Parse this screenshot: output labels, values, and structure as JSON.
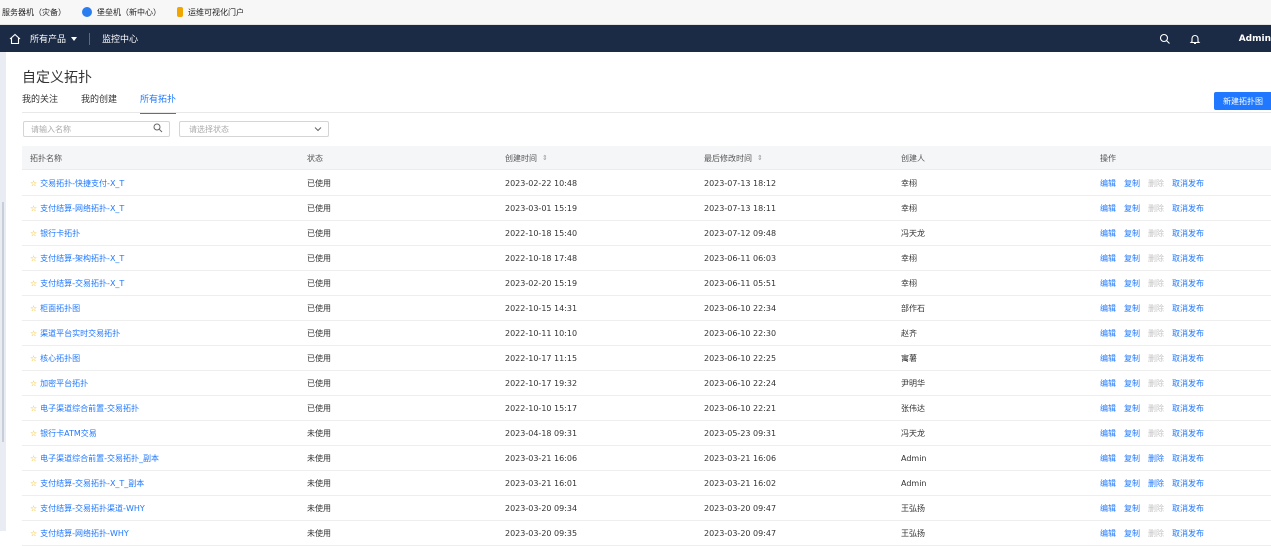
{
  "bookmarks": [
    {
      "label": "服务器机（灾备）",
      "color": "#ffffff"
    },
    {
      "label": "堡垒机（新中心）",
      "color": "#2a7df0"
    },
    {
      "label": "运维可视化门户",
      "color": "#f0a500"
    }
  ],
  "topbar": {
    "home_icon": "home-icon",
    "products_label": "所有产品",
    "monitor_label": "监控中心",
    "user": "Admin"
  },
  "page": {
    "title": "自定义拓扑",
    "tabs": [
      {
        "label": "我的关注",
        "active": false
      },
      {
        "label": "我的创建",
        "active": false
      },
      {
        "label": "所有拓扑",
        "active": true
      }
    ],
    "new_button": "新建拓扑图"
  },
  "filters": {
    "search_placeholder": "请输入名称",
    "status_placeholder": "请选择状态"
  },
  "table": {
    "headers": {
      "name": "拓扑名称",
      "status": "状态",
      "created": "创建时间",
      "modified": "最后修改时间",
      "creator": "创建人",
      "ops": "操作"
    },
    "op_labels": {
      "edit": "编辑",
      "copy": "复制",
      "delete": "删除",
      "unpublish": "取消发布"
    },
    "rows": [
      {
        "name": "交易拓扑-快捷支付-X_T",
        "status": "已使用",
        "created": "2023-02-22 10:48",
        "modified": "2023-07-13 18:12",
        "creator": "幸栩",
        "delete_enabled": false
      },
      {
        "name": "支付结算-网络拓扑-X_T",
        "status": "已使用",
        "created": "2023-03-01 15:19",
        "modified": "2023-07-13 18:11",
        "creator": "幸栩",
        "delete_enabled": false
      },
      {
        "name": "银行卡拓扑",
        "status": "已使用",
        "created": "2022-10-18 15:40",
        "modified": "2023-07-12 09:48",
        "creator": "冯天龙",
        "delete_enabled": false
      },
      {
        "name": "支付结算-架构拓扑-X_T",
        "status": "已使用",
        "created": "2022-10-18 17:48",
        "modified": "2023-06-11 06:03",
        "creator": "幸栩",
        "delete_enabled": false
      },
      {
        "name": "支付结算-交易拓扑-X_T",
        "status": "已使用",
        "created": "2023-02-20 15:19",
        "modified": "2023-06-11 05:51",
        "creator": "幸栩",
        "delete_enabled": false
      },
      {
        "name": "柜面拓扑图",
        "status": "已使用",
        "created": "2022-10-15 14:31",
        "modified": "2023-06-10 22:34",
        "creator": "部作石",
        "delete_enabled": false
      },
      {
        "name": "渠道平台实时交易拓扑",
        "status": "已使用",
        "created": "2022-10-11 10:10",
        "modified": "2023-06-10 22:30",
        "creator": "赵齐",
        "delete_enabled": false
      },
      {
        "name": "核心拓扑图",
        "status": "已使用",
        "created": "2022-10-17 11:15",
        "modified": "2023-06-10 22:25",
        "creator": "寓薯",
        "delete_enabled": false
      },
      {
        "name": "加密平台拓扑",
        "status": "已使用",
        "created": "2022-10-17 19:32",
        "modified": "2023-06-10 22:24",
        "creator": "尹明华",
        "delete_enabled": false
      },
      {
        "name": "电子渠道综合前置-交易拓扑",
        "status": "已使用",
        "created": "2022-10-10 15:17",
        "modified": "2023-06-10 22:21",
        "creator": "张伟达",
        "delete_enabled": false
      },
      {
        "name": "银行卡ATM交易",
        "status": "未使用",
        "created": "2023-04-18 09:31",
        "modified": "2023-05-23 09:31",
        "creator": "冯天龙",
        "delete_enabled": false
      },
      {
        "name": "电子渠道综合前置-交易拓扑_副本",
        "status": "未使用",
        "created": "2023-03-21 16:06",
        "modified": "2023-03-21 16:06",
        "creator": "Admin",
        "delete_enabled": true
      },
      {
        "name": "支付结算-交易拓扑-X_T_副本",
        "status": "未使用",
        "created": "2023-03-21 16:01",
        "modified": "2023-03-21 16:02",
        "creator": "Admin",
        "delete_enabled": true
      },
      {
        "name": "支付结算-交易拓扑渠道-WHY",
        "status": "未使用",
        "created": "2023-03-20 09:34",
        "modified": "2023-03-20 09:47",
        "creator": "王弘扬",
        "delete_enabled": false
      },
      {
        "name": "支付结算-网络拓扑-WHY",
        "status": "未使用",
        "created": "2023-03-20 09:35",
        "modified": "2023-03-20 09:47",
        "creator": "王弘扬",
        "delete_enabled": false
      }
    ]
  }
}
